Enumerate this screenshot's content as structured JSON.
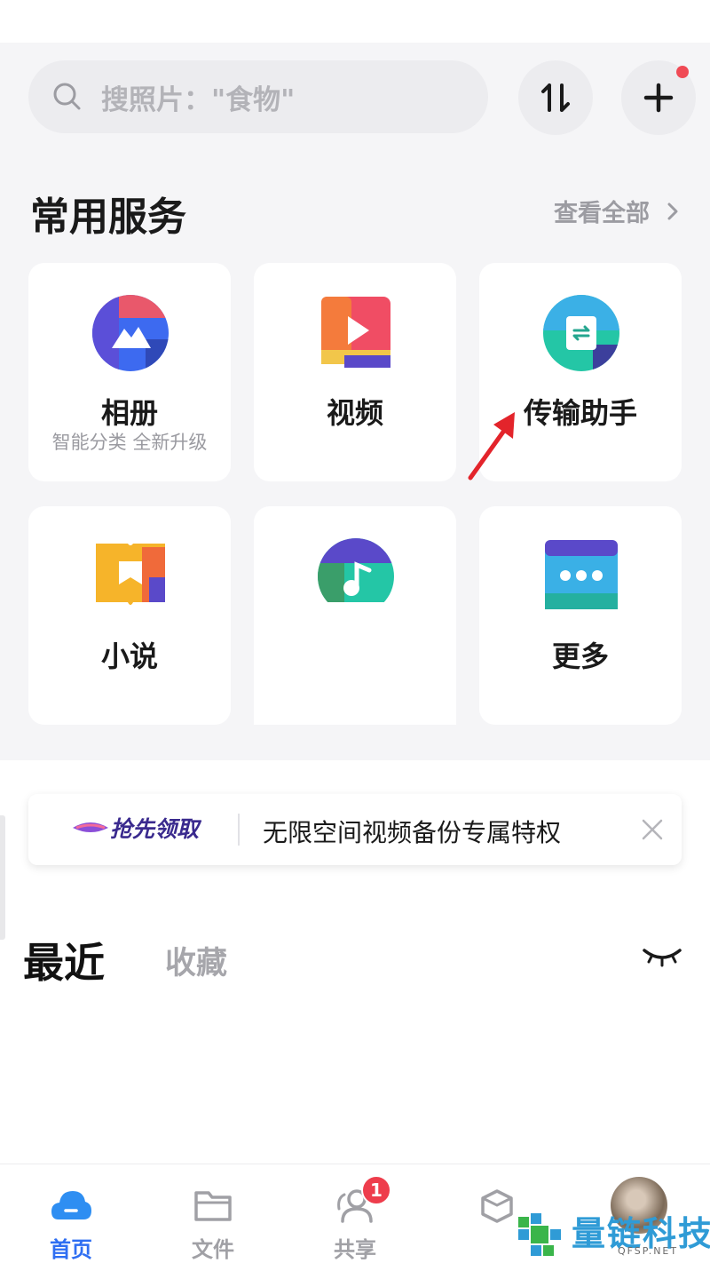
{
  "search": {
    "placeholder": "搜照片：\"食物\"",
    "icon": "search-icon"
  },
  "toolbar": {
    "transfer_icon": "sort-arrows-icon",
    "add_icon": "plus-icon",
    "add_has_notification": true
  },
  "services": {
    "title": "常用服务",
    "view_all": "查看全部",
    "items": [
      {
        "label": "相册",
        "sub": "智能分类 全新升级",
        "icon": "album-icon"
      },
      {
        "label": "视频",
        "icon": "video-icon"
      },
      {
        "label": "传输助手",
        "icon": "transfer-assistant-icon"
      },
      {
        "label": "小说",
        "icon": "novel-icon"
      },
      {
        "label": "",
        "icon": "music-icon"
      },
      {
        "label": "更多",
        "icon": "more-icon"
      }
    ]
  },
  "promo": {
    "badge": "抢先领取",
    "text": "无限空间视频备份专属特权"
  },
  "tabs": {
    "recent": "最近",
    "favorites": "收藏"
  },
  "bottom_nav": {
    "items": [
      {
        "label": "首页",
        "active": true,
        "icon": "cloud-home-icon"
      },
      {
        "label": "文件",
        "active": false,
        "icon": "folder-icon"
      },
      {
        "label": "共享",
        "active": false,
        "icon": "share-people-icon",
        "badge": "1"
      },
      {
        "label": "",
        "active": false,
        "icon": "box-icon"
      },
      {
        "label": "",
        "active": false,
        "icon": "avatar"
      }
    ]
  },
  "watermark": {
    "text": "量链科技",
    "sub": "QFSP.NET"
  },
  "colors": {
    "accent": "#2e6ef2",
    "badge_red": "#ee3d4c",
    "page_bg": "#f5f5f7"
  }
}
